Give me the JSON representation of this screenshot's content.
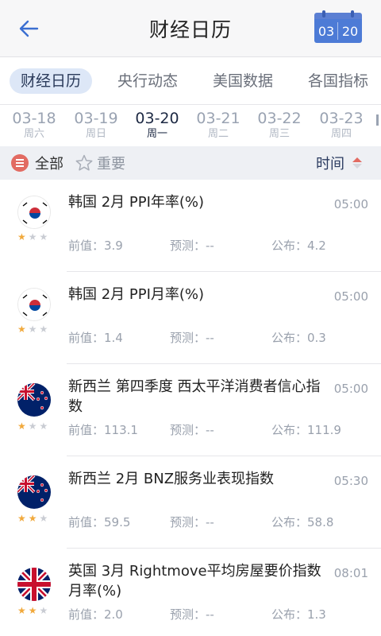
{
  "header": {
    "title": "财经日历",
    "calendar": {
      "month": "03",
      "day": "20"
    }
  },
  "tabs": [
    "财经日历",
    "央行动态",
    "美国数据",
    "各国指标"
  ],
  "dates": [
    {
      "date": "03-18",
      "weekday": "周六"
    },
    {
      "date": "03-19",
      "weekday": "周日"
    },
    {
      "date": "03-20",
      "weekday": "周一"
    },
    {
      "date": "03-21",
      "weekday": "周二"
    },
    {
      "date": "03-22",
      "weekday": "周三"
    },
    {
      "date": "03-23",
      "weekday": "周四"
    }
  ],
  "filter": {
    "all": "全部",
    "important": "重要",
    "time": "时间"
  },
  "colors": {
    "accent": "#4d7bd6",
    "red": "#e26b62",
    "star": "#f1a93c"
  },
  "events": [
    {
      "country_flag": "kr-flag-icon",
      "stars": 1,
      "title": "韩国 2月 PPI年率(%)",
      "time": "05:00",
      "previous": "前值：3.9",
      "forecast": "预测：--",
      "actual": "公布：4.2"
    },
    {
      "country_flag": "kr-flag-icon",
      "stars": 1,
      "title": "韩国 2月 PPI月率(%)",
      "time": "05:00",
      "previous": "前值：1.4",
      "forecast": "预测：--",
      "actual": "公布：0.3"
    },
    {
      "country_flag": "nz-flag-icon",
      "stars": 1,
      "title": "新西兰 第四季度 西太平洋消费者信心指数",
      "time": "05:00",
      "previous": "前值：113.1",
      "forecast": "预测：--",
      "actual": "公布：111.9"
    },
    {
      "country_flag": "nz-flag-icon",
      "stars": 2,
      "title": "新西兰 2月 BNZ服务业表现指数",
      "time": "05:30",
      "previous": "前值：59.5",
      "forecast": "预测：--",
      "actual": "公布：58.8"
    },
    {
      "country_flag": "uk-flag-icon",
      "stars": 2,
      "title": "英国 3月 Rightmove平均房屋要价指数月率(%)",
      "time": "08:01",
      "previous": "前值：2.0",
      "forecast": "预测：--",
      "actual": "公布：1.3"
    }
  ]
}
